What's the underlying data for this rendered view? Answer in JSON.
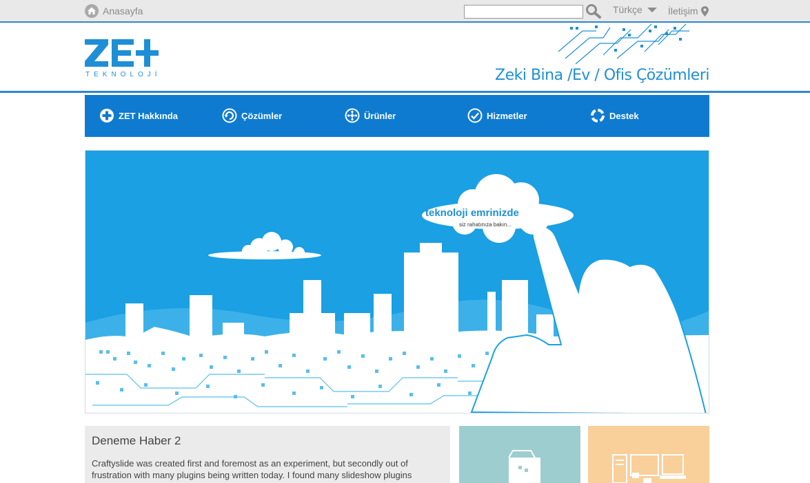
{
  "topbar": {
    "home_label": "Anasayfa",
    "search_value": "",
    "language": "Türkçe",
    "contact_label": "İletişim"
  },
  "header": {
    "logo_text": "ZET",
    "logo_subtitle": "TEKNOLOJİ",
    "tagline": "Zeki Bina /Ev / Ofis Çözümleri"
  },
  "nav": {
    "items": [
      {
        "label": "ZET Hakkında",
        "icon": "plus-circle-icon"
      },
      {
        "label": "Çözümler",
        "icon": "refresh-circle-icon"
      },
      {
        "label": "Ürünler",
        "icon": "network-circle-icon"
      },
      {
        "label": "Hizmetler",
        "icon": "check-circle-icon"
      },
      {
        "label": "Destek",
        "icon": "lifebuoy-icon"
      }
    ]
  },
  "banner": {
    "headline": "teknoloji emrinizde",
    "subline": "siz rahatınıza bakın..."
  },
  "news": {
    "title": "Deneme Haber 2",
    "body": "Craftyslide was created first and foremost as an experiment, but secondly out of frustration with many plugins being written today. I found many slideshow plugins"
  },
  "colors": {
    "brand_blue": "#0f7bd0",
    "sky_blue": "#1aa0e3",
    "tile_teal": "#9ecdd0",
    "tile_orange": "#f9cf9a"
  }
}
